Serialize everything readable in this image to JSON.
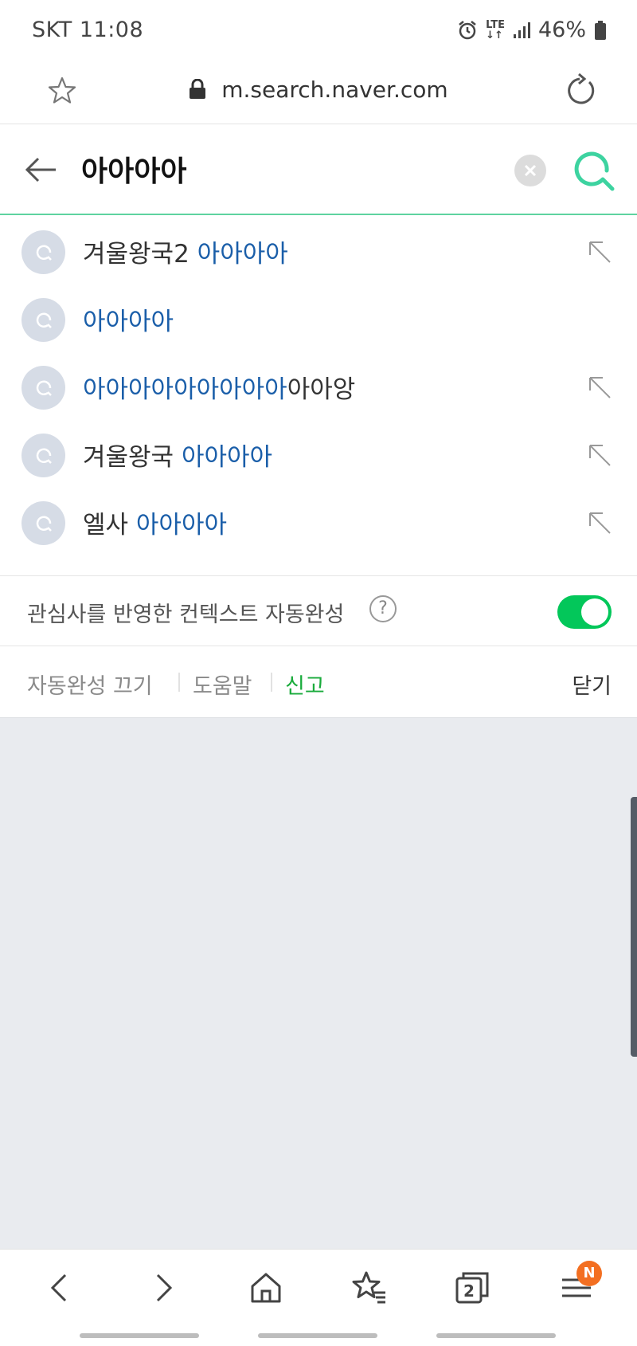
{
  "status_bar": {
    "carrier": "SKT",
    "time": "11:08",
    "network": "LTE",
    "battery": "46%"
  },
  "browser": {
    "url": "m.search.naver.com"
  },
  "search": {
    "query": "아아아아"
  },
  "suggestions": [
    {
      "prefix": "겨울왕국2 ",
      "highlight": "아아아아",
      "suffix": "",
      "has_arrow": true
    },
    {
      "prefix": "",
      "highlight": "아아아아",
      "suffix": "",
      "has_arrow": false
    },
    {
      "prefix": "",
      "highlight": "아아아아아아아아아",
      "suffix": "아아앙",
      "has_arrow": true
    },
    {
      "prefix": "겨울왕국 ",
      "highlight": "아아아아",
      "suffix": "",
      "has_arrow": true
    },
    {
      "prefix": "엘사 ",
      "highlight": "아아아아",
      "suffix": "",
      "has_arrow": true
    }
  ],
  "context_setting": {
    "label": "관심사를 반영한 컨텍스트 자동완성",
    "help": "?",
    "enabled": true
  },
  "footer_links": {
    "autocomplete_off": "자동완성 끄기",
    "help": "도움말",
    "report": "신고",
    "close": "닫기"
  },
  "bottom_nav": {
    "tabs_count": "2",
    "menu_badge": "N"
  },
  "colors": {
    "highlight": "#1a5ea9",
    "brand_green": "#03c75a",
    "search_accent": "#3dd3a0",
    "badge": "#f36f21"
  }
}
